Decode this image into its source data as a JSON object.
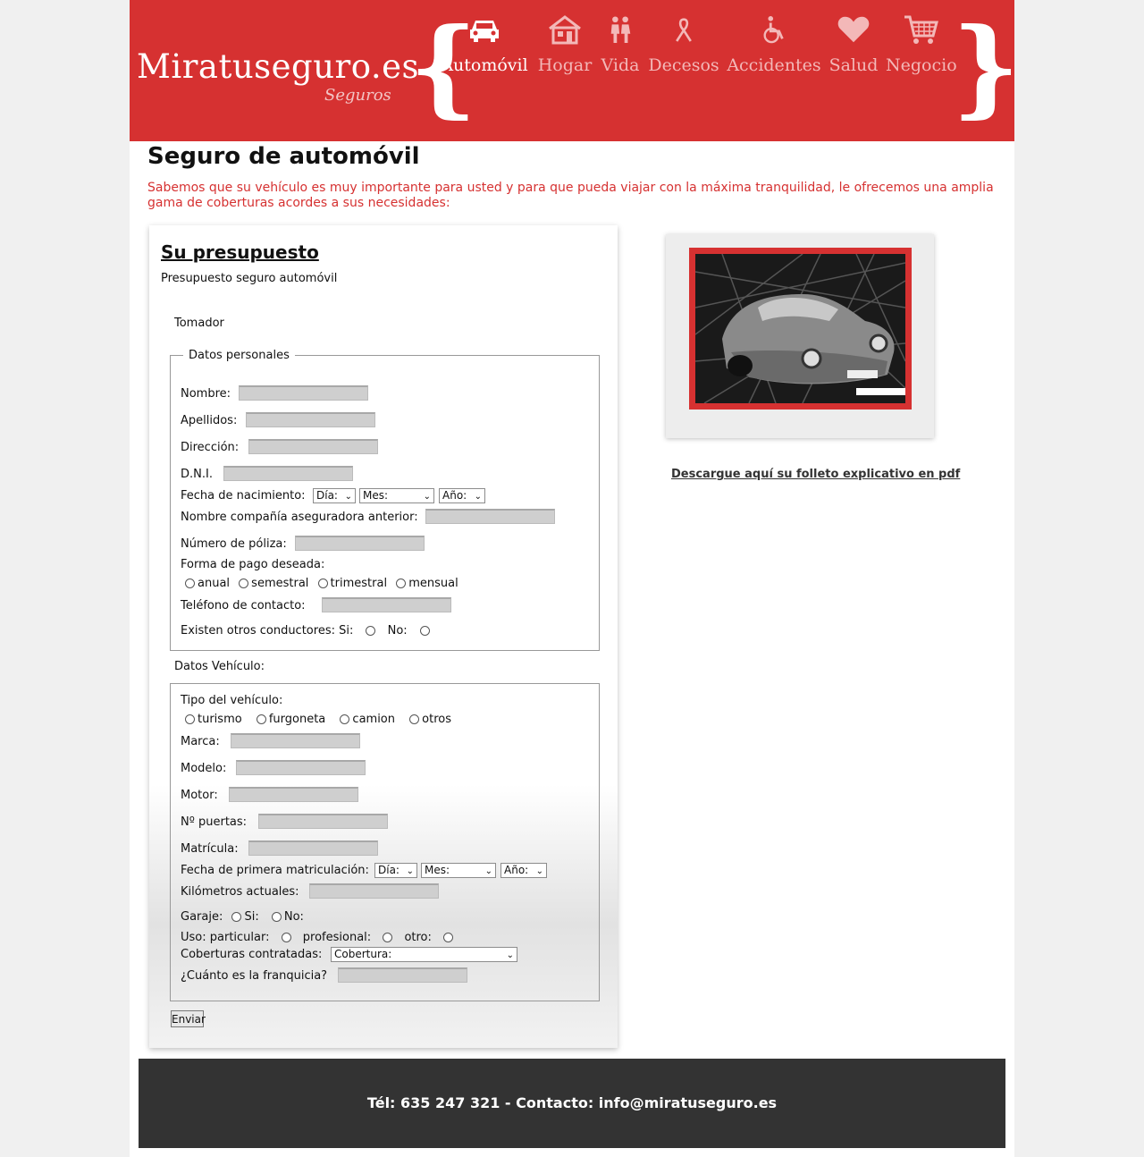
{
  "brand": {
    "name": "Miratuseguro.es",
    "subtitle": "Seguros"
  },
  "colors": {
    "brand_red": "#d63131",
    "footer_bg": "#333333",
    "nav_inactive": "#f3b8b8"
  },
  "nav": [
    {
      "label": "Automóvil",
      "icon": "car-icon",
      "active": true
    },
    {
      "label": "Hogar",
      "icon": "house-icon"
    },
    {
      "label": "Vida",
      "icon": "people-icon"
    },
    {
      "label": "Decesos",
      "icon": "ribbon-icon"
    },
    {
      "label": "Accidentes",
      "icon": "wheelchair-icon"
    },
    {
      "label": "Salud",
      "icon": "heart-icon"
    },
    {
      "label": "Negocio",
      "icon": "cart-icon"
    }
  ],
  "page": {
    "title": "Seguro de automóvil",
    "intro": "Sabemos que su vehículo es muy importante para usted y para que pueda viajar con la máxima tranquilidad, le ofrecemos una amplia gama de coberturas acordes a sus necesidades:"
  },
  "form": {
    "heading": "Su presupuesto",
    "subheading": "Presupuesto seguro automóvil",
    "tomador": "Tomador",
    "personal_legend": "Datos personales",
    "nombre": "Nombre:",
    "apellidos": "Apellidos:",
    "direccion": "Dirección:",
    "dni": "D.N.I.",
    "fecha_nac": "Fecha de nacimiento:",
    "select_dia": "Día:",
    "select_mes": "Mes:",
    "select_anio": "Año:",
    "compania": "Nombre compañía aseguradora anterior:",
    "poliza": "Número de póliza:",
    "forma_pago": "Forma de pago deseada:",
    "pago_anual": "anual",
    "pago_semestral": "semestral",
    "pago_trimestral": "trimestral",
    "pago_mensual": "mensual",
    "telefono": "Teléfono de contacto:",
    "otros_conductores": "Existen otros conductores: Si:",
    "no_label": "No:",
    "vehiculo_title": "Datos Vehículo:",
    "tipo_vehiculo": "Tipo del vehículo:",
    "tipo_turismo": "turismo",
    "tipo_furgoneta": "furgoneta",
    "tipo_camion": "camion",
    "tipo_otros": "otros",
    "marca": "Marca:",
    "modelo": "Modelo:",
    "motor": "Motor:",
    "puertas": "Nº puertas:",
    "matricula": "Matrícula:",
    "fecha_matric": "Fecha de primera matriculación:",
    "km": "Kilómetros actuales:",
    "garaje": "Garaje:",
    "si_label": "Si:",
    "uso": "Uso: particular:",
    "uso_profesional": "profesional:",
    "uso_otro": "otro:",
    "coberturas": "Coberturas contratadas:",
    "select_cobertura": "Cobertura:",
    "franquicia": "¿Cuánto es la franquicia?",
    "submit": "Enviar"
  },
  "sidebar": {
    "pdf_link": "Descargue aquí su folleto explicativo en pdf"
  },
  "footer": {
    "contact": "Tél: 635 247 321 - Contacto: info@miratuseguro.es"
  }
}
